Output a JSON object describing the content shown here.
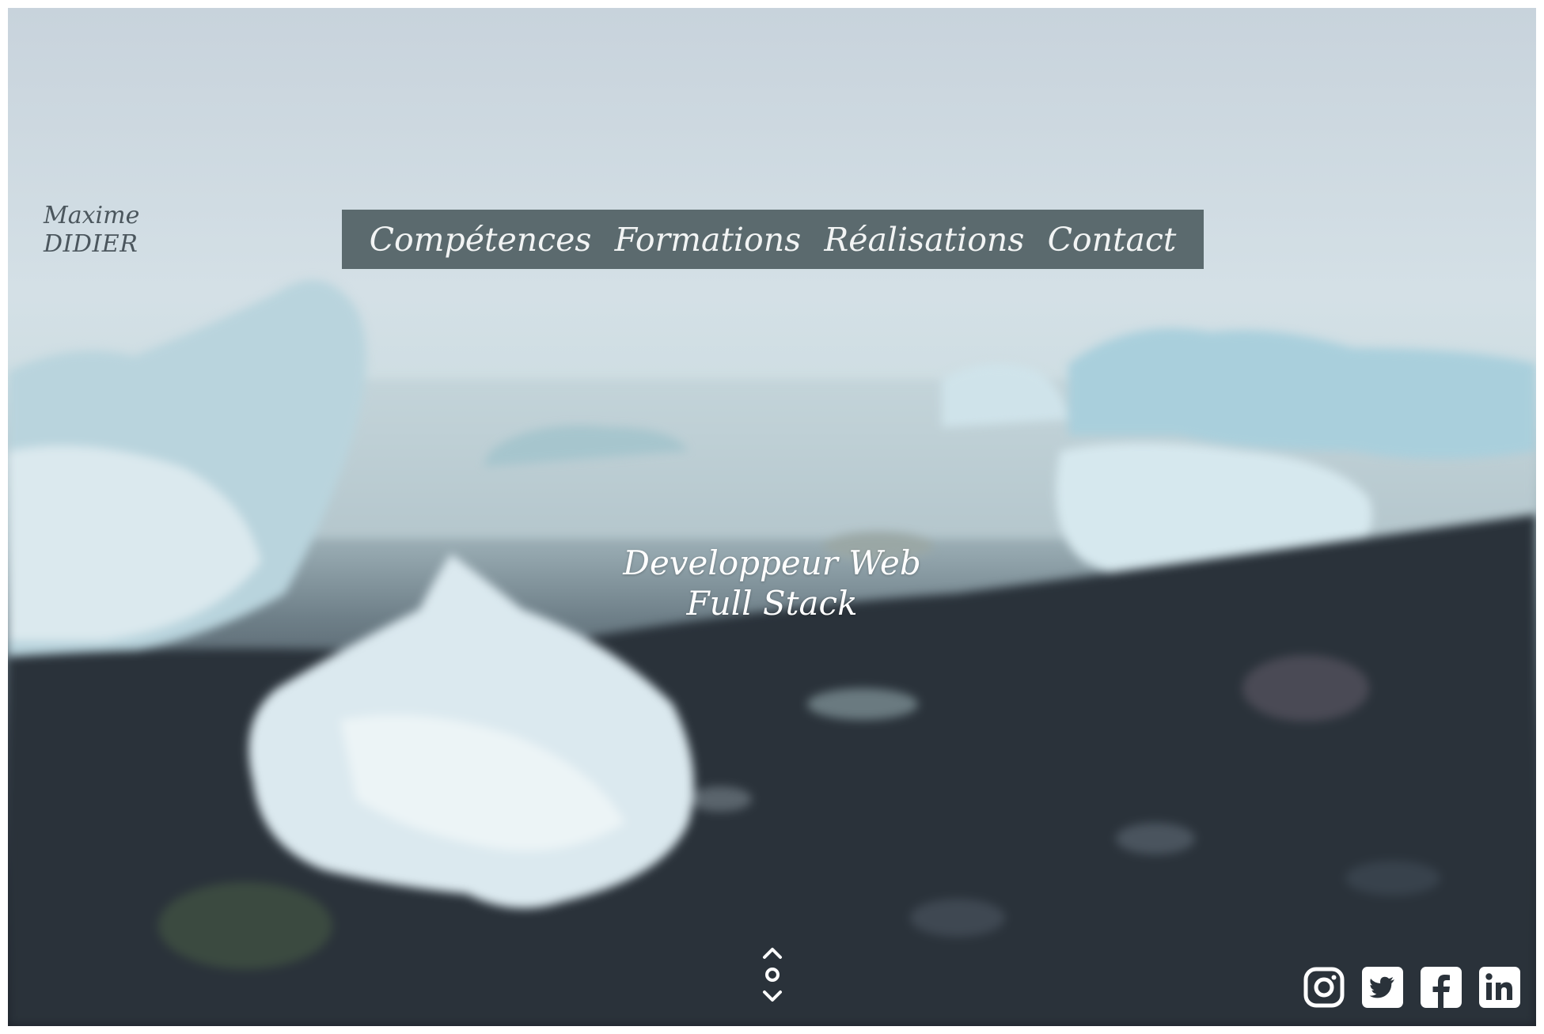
{
  "header": {
    "first_name": "Maxime",
    "last_name": "DIDIER"
  },
  "nav": {
    "items": [
      {
        "label": "Compétences"
      },
      {
        "label": "Formations"
      },
      {
        "label": "Réalisations"
      },
      {
        "label": "Contact"
      }
    ]
  },
  "hero": {
    "line1": "Developpeur Web",
    "line2": "Full Stack"
  },
  "socials": [
    "instagram-icon",
    "twitter-icon",
    "facebook-icon",
    "linkedin-icon"
  ],
  "colors": {
    "nav_background": "#5b6a6e",
    "nav_text": "#f2f4f4",
    "brand_text": "#4b565d",
    "tagline_text": "#ffffff"
  }
}
